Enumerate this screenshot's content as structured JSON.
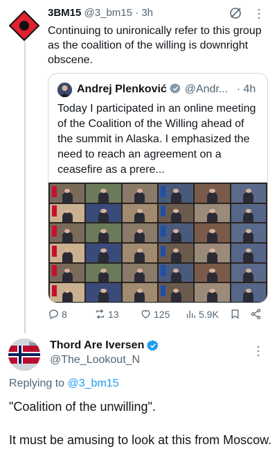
{
  "tweet": {
    "author_name": "3BM15",
    "author_handle": "@3_bm15",
    "separator": " · ",
    "time": "3h",
    "text": "Continuing to unironically refer to this group as the coalition of the willing is downright obscene.",
    "quoted": {
      "author_name": "Andrej Plenković",
      "author_handle": "@Andr...",
      "time": "· 4h",
      "text": "Today I participated in an online meeting of the Coalition of the Willing ahead of the summit in Alaska. I emphasized the need to reach an agreement on a ceasefire as a prere..."
    },
    "stats": {
      "replies": "8",
      "reposts": "13",
      "likes": "125",
      "views": "5.9K"
    }
  },
  "reply": {
    "author_name": "Thord Are Iversen",
    "author_handle": "@The_Lookout_N",
    "replying_prefix": "Replying to ",
    "replying_handle": "@3_bm15",
    "text_line1": "\"Coalition of the unwilling\".",
    "text_line2": "It must be amusing to look at this from Moscow."
  },
  "colors": {
    "accent": "#1d9bf0",
    "secondary_text": "#536471",
    "border": "#cfd9de",
    "verified": "#1d9bf0"
  },
  "icons": [
    "warning-diamond-avatar",
    "grok-icon",
    "more-icon",
    "verified-icon",
    "reply-icon",
    "repost-icon",
    "like-icon",
    "views-icon",
    "bookmark-icon",
    "share-icon",
    "norway-flag-avatar"
  ]
}
